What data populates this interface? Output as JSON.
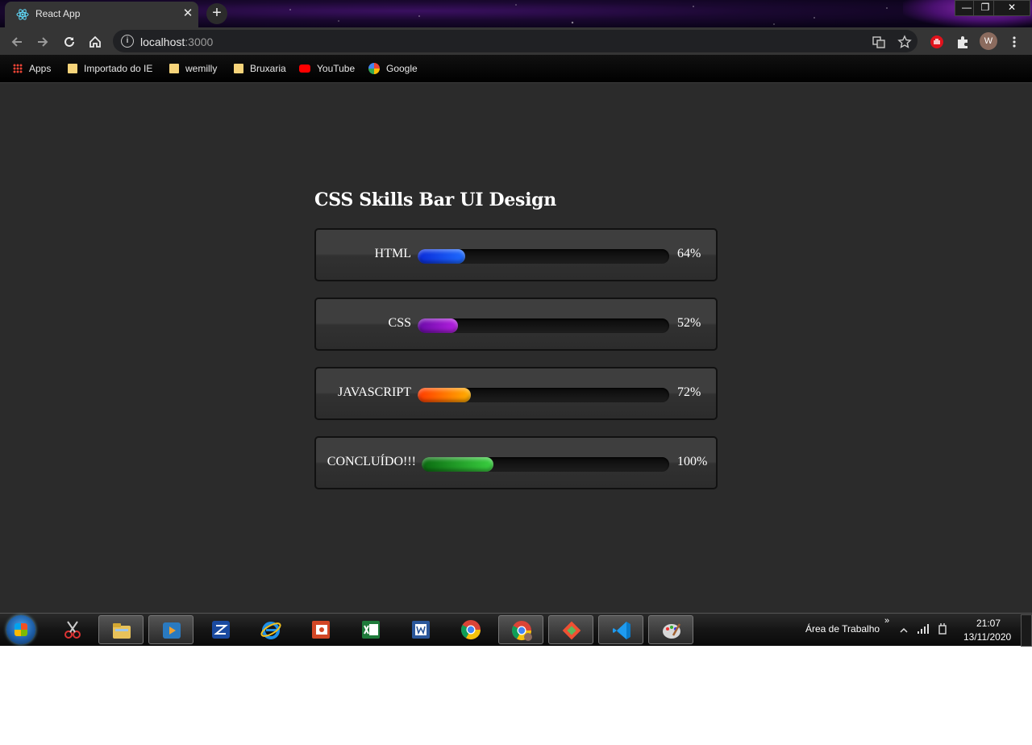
{
  "browser": {
    "tab_title": "React App",
    "tab_close": "✕",
    "new_tab": "+",
    "url_host": "localhost",
    "url_port": ":3000",
    "avatar_letter": "W",
    "window_controls": [
      "—",
      "❐",
      "✕"
    ]
  },
  "bookmarks": [
    {
      "label": "Apps",
      "icon": "apps-grid-icon"
    },
    {
      "label": "Importado do IE",
      "icon": "folder-icon"
    },
    {
      "label": "wemilly",
      "icon": "folder-icon"
    },
    {
      "label": "Bruxaria",
      "icon": "folder-icon"
    },
    {
      "label": "YouTube",
      "icon": "youtube-icon"
    },
    {
      "label": "Google",
      "icon": "google-icon"
    }
  ],
  "page": {
    "title": "CSS Skills Bar UI Design",
    "skills": [
      {
        "label": "HTML",
        "percent_text": "64%",
        "fill_fraction": 0.19,
        "colors": [
          "#0a2bd8",
          "#1e6bff"
        ]
      },
      {
        "label": "CSS",
        "percent_text": "52%",
        "fill_fraction": 0.16,
        "colors": [
          "#6a0aa8",
          "#b520e0"
        ]
      },
      {
        "label": "JAVASCRIPT",
        "percent_text": "72%",
        "fill_fraction": 0.21,
        "colors": [
          "#ff3a00",
          "#ffb000"
        ]
      },
      {
        "label": "CONCLUÍDO!!!",
        "percent_text": "100%",
        "fill_fraction": 0.29,
        "colors": [
          "#0a6a10",
          "#3ad040"
        ]
      }
    ]
  },
  "taskbar": {
    "desktop_label": "Área de Trabalho",
    "expand": "»",
    "time": "21:07",
    "date": "13/11/2020"
  }
}
